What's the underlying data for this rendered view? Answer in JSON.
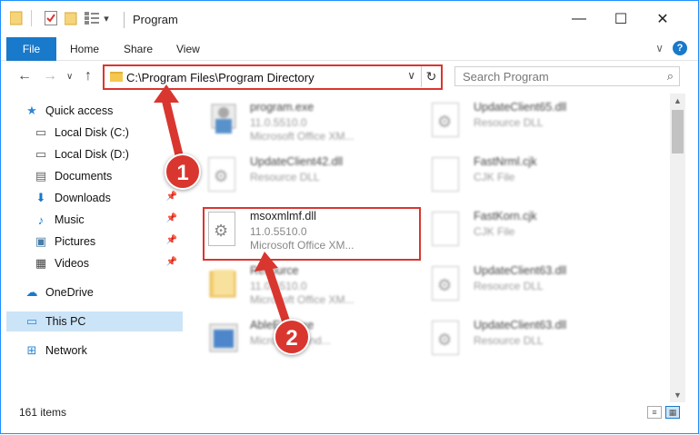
{
  "titlebar": {
    "title": "Program",
    "minimize_glyph": "—",
    "maximize_glyph": "☐",
    "close_glyph": "✕",
    "qa_dropdown_glyph": "▾"
  },
  "ribbon": {
    "tabs": [
      "File",
      "Home",
      "Share",
      "View"
    ],
    "expand_glyph": "∨",
    "help_glyph": "?"
  },
  "nav": {
    "back_glyph": "←",
    "forward_glyph": "→",
    "recent_glyph": "∨",
    "up_glyph": "↑"
  },
  "address": {
    "path": "C:\\Program Files\\Program Directory",
    "dropdown_glyph": "∨",
    "refresh_glyph": "↻"
  },
  "search": {
    "placeholder": "Search Program",
    "icon_glyph": "⌕"
  },
  "navpane": {
    "items": [
      {
        "label": "Quick access",
        "icon": "star-icon",
        "glyph": "★",
        "color": "#2b88d8",
        "pinned": false
      },
      {
        "label": "Local Disk (C:)",
        "icon": "drive-icon",
        "glyph": "▭",
        "color": "#555555",
        "pinned": false
      },
      {
        "label": "Local Disk (D:)",
        "icon": "drive-icon",
        "glyph": "▭",
        "color": "#555555",
        "pinned": false
      },
      {
        "label": "Documents",
        "icon": "documents-icon",
        "glyph": "▤",
        "color": "#666666",
        "pinned": false
      },
      {
        "label": "Downloads",
        "icon": "download-icon",
        "glyph": "⬇",
        "color": "#1979ca",
        "pinned": true
      },
      {
        "label": "Music",
        "icon": "music-icon",
        "glyph": "♪",
        "color": "#1979ca",
        "pinned": true
      },
      {
        "label": "Pictures",
        "icon": "pictures-icon",
        "glyph": "▣",
        "color": "#4a7da8",
        "pinned": true
      },
      {
        "label": "Videos",
        "icon": "video-icon",
        "glyph": "▦",
        "color": "#444444",
        "pinned": true
      },
      {
        "label": "OneDrive",
        "icon": "cloud-icon",
        "glyph": "☁",
        "color": "#1979ca",
        "pinned": false
      },
      {
        "label": "This PC",
        "icon": "monitor-icon",
        "glyph": "▭",
        "color": "#2b88d8",
        "pinned": false,
        "selected": true
      },
      {
        "label": "Network",
        "icon": "network-icon",
        "glyph": "⊞",
        "color": "#2b88d8",
        "pinned": false
      }
    ],
    "pin_glyph": "📌"
  },
  "files": [
    {
      "name": "program.exe",
      "line2": "11.0.5510.0",
      "line3": "Microsoft Office XM...",
      "icon": "exe-icon",
      "blur": true
    },
    {
      "name": "UpdateClient65.dll",
      "line2": "Resource DLL",
      "line3": "",
      "icon": "dll-icon",
      "blur": true
    },
    {
      "name": "UpdateClient42.dll",
      "line2": "Resource DLL",
      "line3": "",
      "icon": "dll-icon",
      "blur": true
    },
    {
      "name": "FastNrml.cjk",
      "line2": "CJK File",
      "line3": "",
      "icon": "cjk-file-icon",
      "blur": true
    },
    {
      "name": "msoxmlmf.dll",
      "line2": "11.0.5510.0",
      "line3": "Microsoft Office XM...",
      "icon": "dll-gear-icon",
      "blur": false
    },
    {
      "name": "FastKorn.cjk",
      "line2": "CJK File",
      "line3": "",
      "icon": "cjk-file-icon",
      "blur": true
    },
    {
      "name": "Resource",
      "line2": "11.0.5510.0",
      "line3": "Microsoft Office XM...",
      "icon": "folder-icon",
      "blur": true
    },
    {
      "name": "UpdateClient63.dll",
      "line2": "Resource DLL",
      "line3": "",
      "icon": "dll-icon",
      "blur": true
    },
    {
      "name": "AbleExe.exe",
      "line2": "Microsoft hand...",
      "line3": "",
      "icon": "exe-icon",
      "blur": true
    },
    {
      "name": "UpdateClient63.dll",
      "line2": "Resource DLL",
      "line3": "",
      "icon": "dll-icon",
      "blur": true
    }
  ],
  "status": {
    "item_count": "161 items",
    "view_details_glyph": "≡",
    "view_tiles_glyph": "▦"
  },
  "annotations": {
    "step1": "1",
    "step2": "2",
    "accent": "#d9362f"
  },
  "scrollbar": {
    "up_glyph": "▲",
    "down_glyph": "▼"
  }
}
